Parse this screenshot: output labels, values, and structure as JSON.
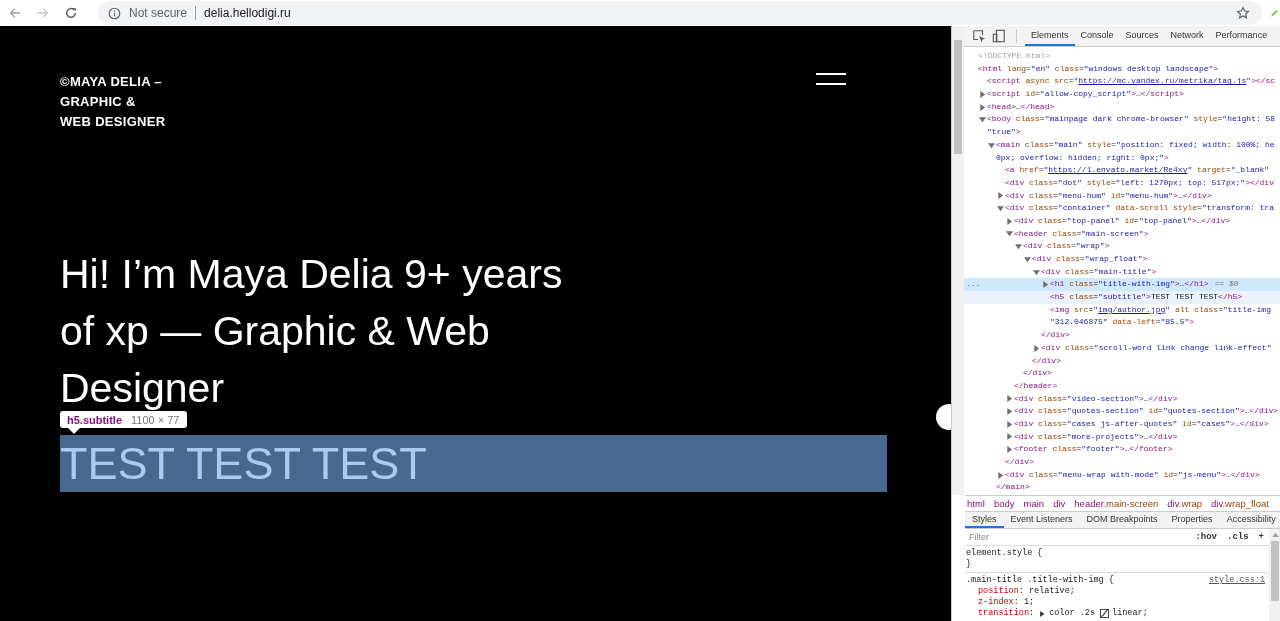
{
  "browser": {
    "security": "Not secure",
    "url": "delia.hellodigi.ru"
  },
  "page": {
    "logo": [
      "©MAYA DELIA –",
      "GRAPHIC &",
      "WEB DESIGNER"
    ],
    "heading": "Hi! I’m Maya Delia 9+ years of xp — Graphic & Web Designer",
    "subtitle": "TEST TEST TEST",
    "tooltip": {
      "selector": "h5.subtitle",
      "size": "1100 × 77"
    }
  },
  "devtools": {
    "tabs": [
      {
        "label": "Elements",
        "selected": true
      },
      {
        "label": "Console",
        "selected": false
      },
      {
        "label": "Sources",
        "selected": false
      },
      {
        "label": "Network",
        "selected": false
      },
      {
        "label": "Performance",
        "selected": false
      }
    ],
    "dom": [
      {
        "text": "<!DOCTYPE html>",
        "selected": false,
        "hovered": false
      },
      {
        "text": "<html lang=\"en\" class=\"windows desktop landscape\">",
        "selected": false,
        "hovered": false,
        "children": [
          {
            "text": "<script async src=\"https://mc.yandex.ru/metrika/tag.js\"></sc",
            "link": true,
            "selected": false,
            "hovered": false
          },
          {
            "text": "<script id=\"allow-copy_script\">…</script>",
            "expanded": false,
            "selected": false,
            "hovered": false
          },
          {
            "text": "<head>…</head>",
            "expanded": false,
            "selected": false,
            "hovered": false
          },
          {
            "text": "<body class=\"mainpage dark chrome-browser\" style=\"height: 58",
            "cont": "\"true\">",
            "expanded": true,
            "selected": false,
            "hovered": false,
            "children": [
              {
                "text": "<main class=\"main\" style=\"position: fixed; width: 100%; he",
                "cont": "0px; overflow: hidden; right: 0px;\">",
                "expanded": true,
                "selected": false,
                "hovered": false,
                "close": "</main>",
                "children": [
                  {
                    "text": "<a href=\"https://1.envato.market/Re4xy\" target=\"_blank\"",
                    "link": true,
                    "selected": false,
                    "hovered": false
                  },
                  {
                    "text": "<div class=\"dot\" style=\"left: 1270px; top: 517px;\"></div",
                    "selected": false,
                    "hovered": false
                  },
                  {
                    "text": "<div class=\"menu-hum\" id=\"menu-hum\">…</div>",
                    "expanded": false,
                    "selected": false,
                    "hovered": false
                  },
                  {
                    "text": "<div class=\"container\" data-scroll style=\"transform: tra",
                    "expanded": true,
                    "selected": false,
                    "hovered": false,
                    "close": "</div>",
                    "children": [
                      {
                        "text": "<div class=\"top-panel\" id=\"top-panel\">…</div>",
                        "expanded": false,
                        "selected": false,
                        "hovered": false
                      },
                      {
                        "text": "<header class=\"main-screen\">",
                        "expanded": true,
                        "selected": false,
                        "hovered": false,
                        "close": "</header>",
                        "children": [
                          {
                            "text": "<div class=\"wrap\">",
                            "expanded": true,
                            "selected": false,
                            "hovered": false,
                            "close": "</div>",
                            "children": [
                              {
                                "text": "<div class=\"wrap_float\">",
                                "expanded": true,
                                "selected": false,
                                "hovered": false,
                                "close": "</div>",
                                "children": [
                                  {
                                    "text": "<div class=\"main-title\">",
                                    "expanded": true,
                                    "selected": false,
                                    "hovered": false,
                                    "close": "</div>",
                                    "children": [
                                      {
                                        "text": "<h1 class=\"title-with-img\">…</h1>",
                                        "suffix": "== $0",
                                        "marker": "...",
                                        "expanded": false,
                                        "selected": true,
                                        "hovered": false
                                      },
                                      {
                                        "text": "<h5 class=\"subtitle\">TEST TEST TEST</h5>",
                                        "selected": false,
                                        "hovered": true
                                      },
                                      {
                                        "text": "<img src=\"img/author.jpg\" alt class=\"title-img",
                                        "cont": "\"312.046875\" data-left=\"85.5\">",
                                        "link": true,
                                        "selected": false,
                                        "hovered": false
                                      }
                                    ]
                                  },
                                  {
                                    "text": "<div class=\"scroll-word link change link-effect\"",
                                    "expanded": false,
                                    "selected": false,
                                    "hovered": false
                                  }
                                ]
                              }
                            ]
                          }
                        ]
                      },
                      {
                        "text": "<div class=\"video-section\">…</div>",
                        "expanded": false,
                        "selected": false,
                        "hovered": false
                      },
                      {
                        "text": "<div class=\"quotes-section\" id=\"quotes-section\">…</div>",
                        "expanded": false,
                        "selected": false,
                        "hovered": false
                      },
                      {
                        "text": "<div class=\"cases js-after-quotes\" id=\"cases\">…</div>",
                        "expanded": false,
                        "selected": false,
                        "hovered": false
                      },
                      {
                        "text": "<div class=\"more-projects\">…</div>",
                        "expanded": false,
                        "selected": false,
                        "hovered": false
                      },
                      {
                        "text": "<footer class=\"footer\">…</footer>",
                        "expanded": false,
                        "selected": false,
                        "hovered": false
                      }
                    ]
                  },
                  {
                    "text": "<div class=\"menu-wrap with-mode\" id=\"js-menu\">…</div>",
                    "expanded": false,
                    "selected": false,
                    "hovered": false
                  }
                ]
              }
            ]
          }
        ]
      }
    ],
    "breadcrumbs": [
      "html",
      "body",
      "main",
      "div",
      "header.main-screen",
      "div.wrap",
      "div.wrap_float"
    ],
    "pane_tabs": [
      {
        "label": "Styles",
        "selected": true
      },
      {
        "label": "Event Listeners",
        "selected": false
      },
      {
        "label": "DOM Breakpoints",
        "selected": false
      },
      {
        "label": "Properties",
        "selected": false
      },
      {
        "label": "Accessibility",
        "selected": false
      }
    ],
    "styles": {
      "filter_placeholder": "Filter",
      "buttons": [
        ":hov",
        ".cls",
        "+"
      ],
      "rules": [
        {
          "selector": "element.style",
          "open": "{",
          "close": "}"
        },
        {
          "selector": ".main-title .title-with-img",
          "open": "{",
          "source": "style.css:1",
          "declarations": [
            {
              "property": "position",
              "value": ": relative;"
            },
            {
              "property": "z-index",
              "value": ": 1;"
            },
            {
              "property": "transition",
              "value": ":",
              "expanded": false,
              "shorthand": "color .2s",
              "easing": "linear;"
            }
          ]
        }
      ]
    }
  }
}
